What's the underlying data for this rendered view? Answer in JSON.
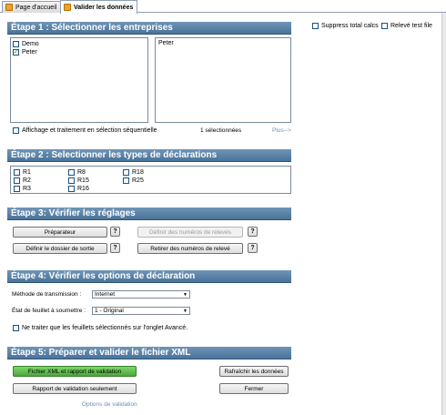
{
  "tabs": [
    {
      "label": "Page d'accueil"
    },
    {
      "label": "Valider les données"
    }
  ],
  "top_options": {
    "suppress_label": "Suppress total calcs",
    "releve_test_label": "Relevé test file"
  },
  "step1": {
    "title": "Étape 1 : Sélectionner les entreprises",
    "companies": [
      {
        "label": "Demo",
        "checked": false
      },
      {
        "label": "Peter",
        "checked": true
      }
    ],
    "selected_list": [
      "Peter"
    ],
    "sequential_label": "Affichage et traitement en sélection séquentielle",
    "selected_count": "1 sélectionnées",
    "more_link": "Plus-->"
  },
  "step2": {
    "title": "Étape 2 : Selectionner les types de déclarations",
    "col1": [
      "R1",
      "R2",
      "R3"
    ],
    "col2": [
      "R8",
      "R15",
      "R16"
    ],
    "col3": [
      "R18",
      "R25"
    ]
  },
  "step3": {
    "title": "Étape 3: Vérifier les réglages",
    "preparer": "Préparateur",
    "define_numbers": "Définir des numéros de relevés",
    "output_folder": "Définir le dossier de sortie",
    "remove_numbers": "Retirer des numéros de relevé",
    "help": "?"
  },
  "step4": {
    "title": "Étape 4: Vérifier les options de déclaration",
    "transmission_label": "Méthode de transmission :",
    "transmission_value": "Internet",
    "sheet_state_label": "État de feuillet à soumettre :",
    "sheet_state_value": "1 - Original",
    "only_selected_label": "Ne traiter que les feuillets sélectionnés sur l'onglet Avancé."
  },
  "step5": {
    "title": "Étape 5: Préparer et valider le fichier XML",
    "xml_button": "Fichier XML et rapport de validation",
    "refresh_button": "Rafraîchir les données",
    "report_button": "Rapport de validation seulement",
    "close_button": "Fermer",
    "options_link": "Options de validation"
  },
  "colors": {
    "header_bg": "#5a82a8",
    "green_button": "#5bbf48",
    "link": "#6b8fb5"
  }
}
